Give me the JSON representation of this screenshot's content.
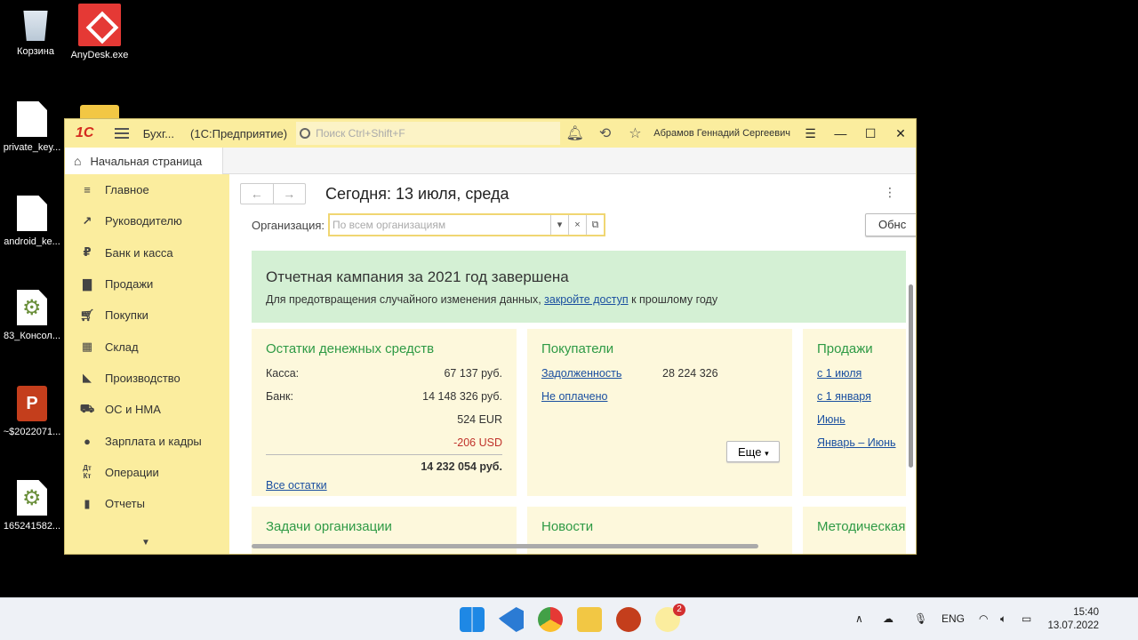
{
  "desktop": {
    "icons": [
      {
        "label": "Корзина"
      },
      {
        "label": "AnyDesk.exe"
      },
      {
        "label": "private_key..."
      },
      {
        "label": "android_ke..."
      },
      {
        "label": "83_Консол..."
      },
      {
        "label": "~$2022071..."
      },
      {
        "label": "165241582..."
      }
    ]
  },
  "window": {
    "logo": "1С",
    "title": "Бухг...",
    "subtitle": "(1С:Предприятие)",
    "search_placeholder": "Поиск Ctrl+Shift+F",
    "user": "Абрамов Геннадий Сергеевич",
    "tab": "Начальная страница"
  },
  "sidebar": {
    "items": [
      {
        "label": "Главное",
        "icon": "menu-icon"
      },
      {
        "label": "Руководителю",
        "icon": "trend-icon"
      },
      {
        "label": "Банк и касса",
        "icon": "ruble-icon"
      },
      {
        "label": "Продажи",
        "icon": "bag-icon"
      },
      {
        "label": "Покупки",
        "icon": "cart-icon"
      },
      {
        "label": "Склад",
        "icon": "warehouse-icon"
      },
      {
        "label": "Производство",
        "icon": "factory-icon"
      },
      {
        "label": "ОС и НМА",
        "icon": "truck-icon"
      },
      {
        "label": "Зарплата и кадры",
        "icon": "person-icon"
      },
      {
        "label": "Операции",
        "icon": "dt-kt-icon"
      },
      {
        "label": "Отчеты",
        "icon": "bar-chart-icon"
      }
    ]
  },
  "main": {
    "title": "Сегодня: 13 июля, среда",
    "org_label": "Организация:",
    "org_placeholder": "По всем организациям",
    "refresh_label": "Обнс",
    "banner": {
      "title": "Отчетная кампания за 2021 год завершена",
      "text_before": "Для предотвращения случайного изменения данных,",
      "link": "закройте доступ",
      "text_after": "к прошлому году"
    },
    "cash": {
      "title": "Остатки денежных средств",
      "rows": [
        {
          "label": "Касса:",
          "value": "67 137 руб."
        },
        {
          "label": "Банк:",
          "value": "14 148 326 руб."
        },
        {
          "label": "",
          "value": "524 EUR"
        },
        {
          "label": "",
          "value": "-206 USD"
        }
      ],
      "total": "14 232 054 руб.",
      "all_link": "Все остатки"
    },
    "customers": {
      "title": "Покупатели",
      "debt_link": "Задолженность",
      "debt_value": "28 224 326",
      "unpaid_link": "Не оплачено",
      "more": "Еще"
    },
    "sales": {
      "title": "Продажи",
      "links": [
        "с 1 июля",
        "с 1 января",
        "Июнь",
        "Январь – Июнь"
      ]
    },
    "tasks_title": "Задачи организации",
    "news_title": "Новости",
    "method_title": "Методическая"
  },
  "taskbar": {
    "lang": "ENG",
    "time": "15:40",
    "date": "13.07.2022",
    "badge": "2"
  }
}
